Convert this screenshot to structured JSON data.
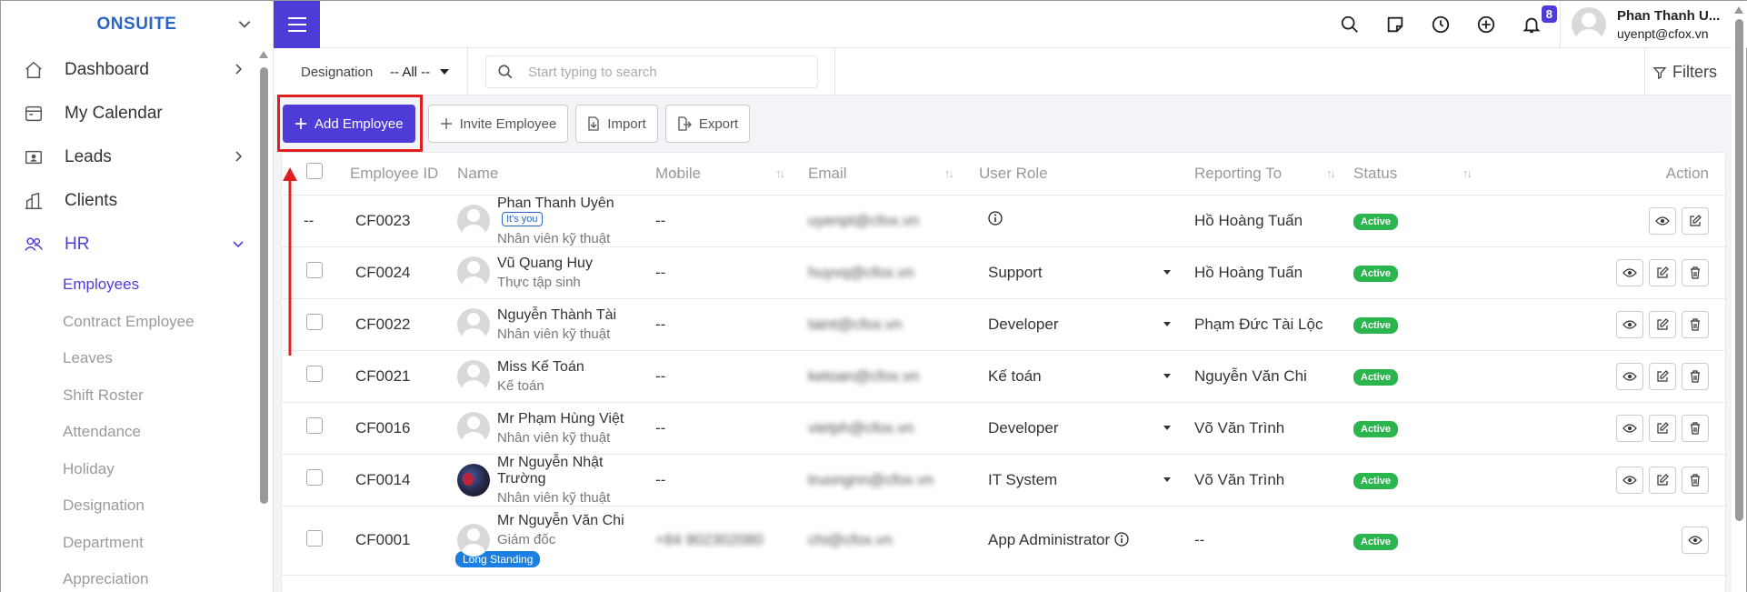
{
  "brand": "ONSUITE",
  "sidebar": {
    "items": [
      {
        "label": "Dashboard"
      },
      {
        "label": "My Calendar"
      },
      {
        "label": "Leads"
      },
      {
        "label": "Clients"
      },
      {
        "label": "HR"
      }
    ],
    "hr_sub": [
      "Employees",
      "Contract Employee",
      "Leaves",
      "Shift Roster",
      "Attendance",
      "Holiday",
      "Designation",
      "Department",
      "Appreciation"
    ]
  },
  "topbar": {
    "notification_count": "8",
    "user_name": "Phan Thanh U...",
    "user_email": "uyenpt@cfox.vn"
  },
  "filterbar": {
    "designation_label": "Designation",
    "designation_value": "-- All --",
    "search_placeholder": "Start typing to search",
    "filters_label": "Filters"
  },
  "actions": {
    "add": "Add Employee",
    "invite": "Invite Employee",
    "import": "Import",
    "export": "Export"
  },
  "table": {
    "headers": [
      "Employee ID",
      "Name",
      "Mobile",
      "Email",
      "User Role",
      "Reporting To",
      "Status",
      "Action"
    ],
    "rows": [
      {
        "id": "CF0023",
        "name": "Phan Thanh Uyên",
        "title": "Nhân viên kỹ thuật",
        "tag": "It's you",
        "mobile": "--",
        "email": "uyenpt@cfox.vn",
        "role": "",
        "reporting": "Hồ Hoàng Tuấn",
        "status": "Active"
      },
      {
        "id": "CF0024",
        "name": "Vũ Quang Huy",
        "title": "Thực tập sinh",
        "mobile": "--",
        "email": "huyvq@cfox.vn",
        "role": "Support",
        "reporting": "Hồ Hoàng Tuấn",
        "status": "Active"
      },
      {
        "id": "CF0022",
        "name": "Nguyễn Thành Tài",
        "title": "Nhân viên kỹ thuật",
        "mobile": "--",
        "email": "taint@cfox.vn",
        "role": "Developer",
        "reporting": "Phạm Đức Tài Lộc",
        "status": "Active"
      },
      {
        "id": "CF0021",
        "name": "Miss Kế Toán",
        "title": "Kế toán",
        "mobile": "--",
        "email": "ketoan@cfox.vn",
        "role": "Kế toán",
        "reporting": "Nguyễn Văn Chi",
        "status": "Active"
      },
      {
        "id": "CF0016",
        "name": "Mr Phạm Hùng Việt",
        "title": "Nhân viên kỹ thuật",
        "mobile": "--",
        "email": "vietph@cfox.vn",
        "role": "Developer",
        "reporting": "Võ Văn Trình",
        "status": "Active"
      },
      {
        "id": "CF0014",
        "name": "Mr Nguyễn Nhật Trường",
        "title": "Nhân viên kỹ thuật",
        "mobile": "--",
        "email": "truongnn@cfox.vn",
        "role": "IT System",
        "reporting": "Võ Văn Trình",
        "status": "Active"
      },
      {
        "id": "CF0001",
        "name": "Mr Nguyễn Văn Chi",
        "title": "Giám đốc",
        "tag": "Long Standing",
        "mobile": "+84 902302080",
        "email": "chi@cfox.vn",
        "role": "App Administrator",
        "reporting": "--",
        "status": "Active"
      }
    ],
    "first_row_checkbox_placeholder": "--"
  },
  "colors": {
    "accent": "#4e3cd9",
    "active_status": "#2bb54d",
    "highlight": "#e02020"
  },
  "icons": [
    "home-icon",
    "calendar-icon",
    "leads-icon",
    "clients-icon",
    "hr-icon",
    "search-icon",
    "sticky-note-icon",
    "clock-icon",
    "plus-circle-icon",
    "bell-icon",
    "filter-icon",
    "eye-icon",
    "edit-icon",
    "trash-icon"
  ]
}
